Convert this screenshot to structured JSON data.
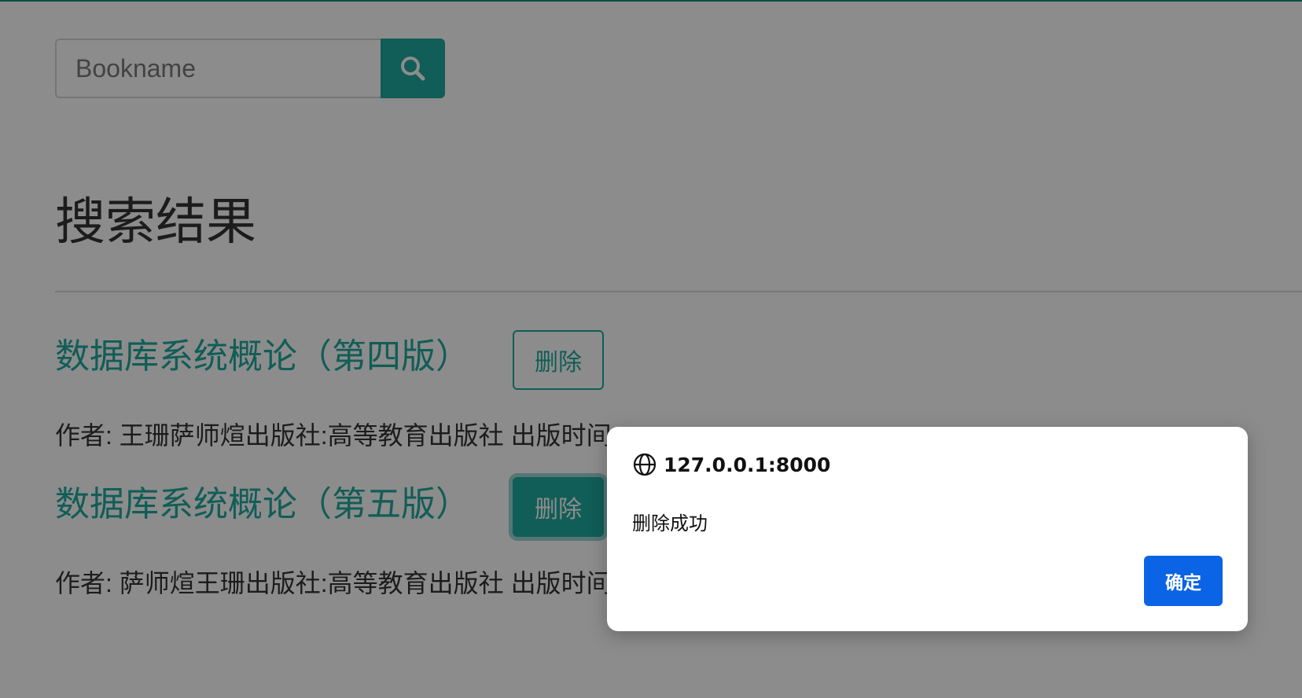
{
  "search": {
    "placeholder": "Bookname",
    "value": "",
    "button_icon": "search-icon"
  },
  "results": {
    "heading": "搜索结果",
    "books": [
      {
        "title": "数据库系统概论（第四版）",
        "delete_label": "删除",
        "meta": "作者: 王珊萨师煊出版社:高等教育出版社 出版时间"
      },
      {
        "title": "数据库系统概论（第五版）",
        "delete_label": "删除",
        "meta": "作者: 萨师煊王珊出版社:高等教育出版社 出版时间"
      }
    ]
  },
  "dialog": {
    "origin": "127.0.0.1:8000",
    "origin_icon": "globe-icon",
    "message": "删除成功",
    "ok_label": "确定"
  },
  "colors": {
    "accent": "#1fa99e",
    "dialog_button": "#0b63e5",
    "overlay": "rgba(0,0,0,0.45)"
  }
}
